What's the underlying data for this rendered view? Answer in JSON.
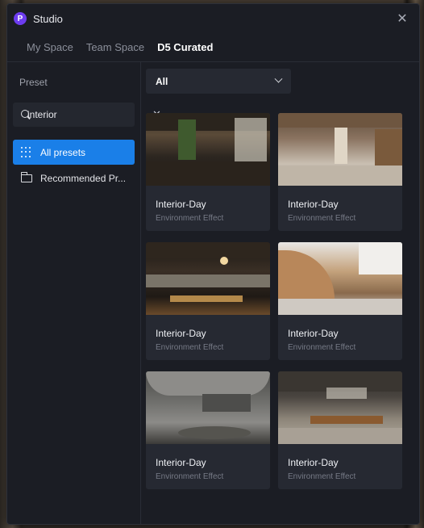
{
  "window": {
    "title": "Studio",
    "logo_letter": "P"
  },
  "tabs": [
    {
      "label": "My Space",
      "active": false
    },
    {
      "label": "Team Space",
      "active": false
    },
    {
      "label": "D5 Curated",
      "active": true
    }
  ],
  "sidebar": {
    "heading": "Preset",
    "search": {
      "value": "interior"
    },
    "items": [
      {
        "label": "All presets",
        "icon": "grid-icon",
        "active": true
      },
      {
        "label": "Recommended Pr...",
        "icon": "folder-icon",
        "active": false
      }
    ]
  },
  "filter": {
    "selected": "All"
  },
  "cards": [
    {
      "title": "Interior-Day",
      "subtitle": "Environment Effect"
    },
    {
      "title": "Interior-Day",
      "subtitle": "Environment Effect"
    },
    {
      "title": "Interior-Day",
      "subtitle": "Environment Effect"
    },
    {
      "title": "Interior-Day",
      "subtitle": "Environment Effect"
    },
    {
      "title": "Interior-Day",
      "subtitle": "Environment Effect"
    },
    {
      "title": "Interior-Day",
      "subtitle": "Environment Effect"
    }
  ],
  "colors": {
    "accent": "#1a7fe8",
    "window_bg": "#1b1d24",
    "card_bg": "#262932",
    "logo": "#6d3cf0"
  }
}
